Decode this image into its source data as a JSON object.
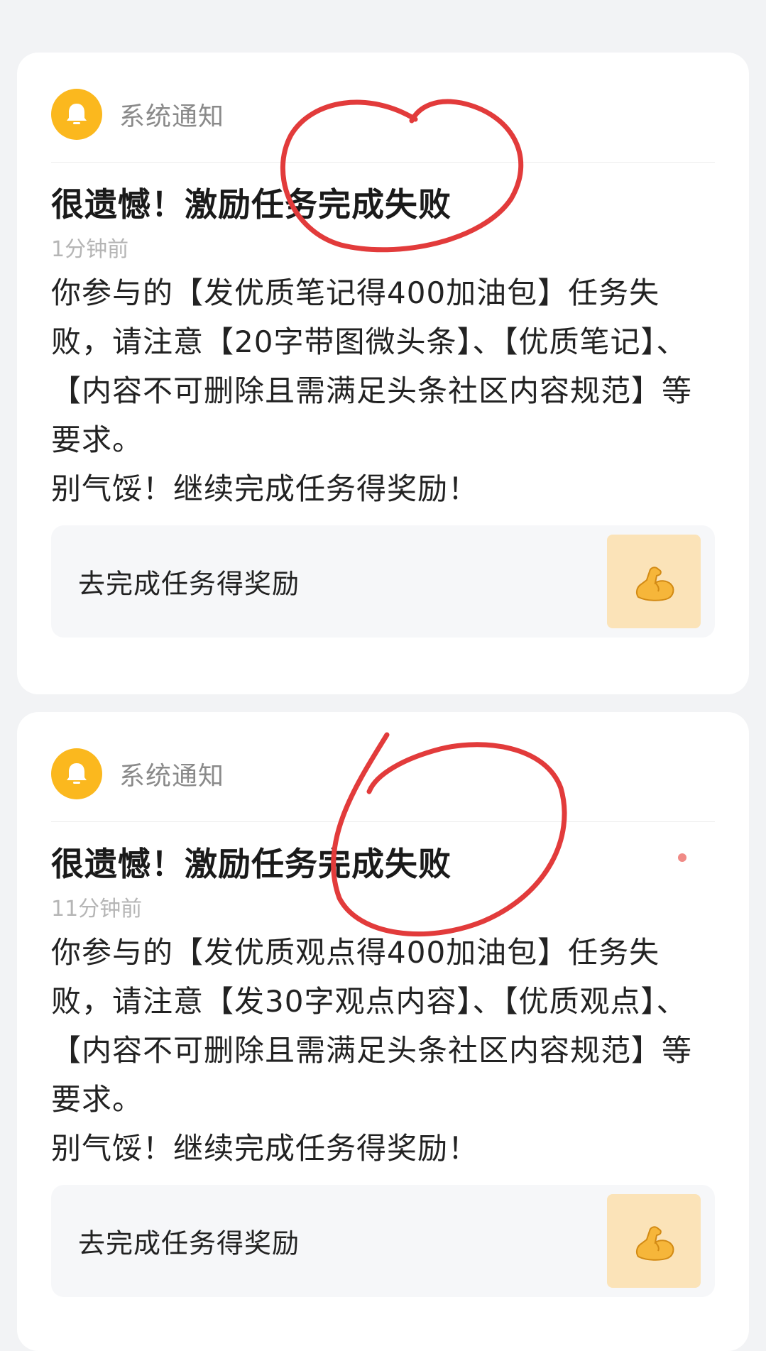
{
  "notifications": [
    {
      "sender": "系统通知",
      "title": "很遗憾！激励任务完成失败",
      "time": "1分钟前",
      "body_lines": [
        "你参与的【发优质笔记得400加油包】任务失败，请注意【20字带图微头条】、【优质笔记】、【内容不可删除且需满足头条社区内容规范】等要求。",
        "别气馁！继续完成任务得奖励！"
      ],
      "action_label": "去完成任务得奖励",
      "action_icon": "flexed-biceps-icon",
      "unread": false
    },
    {
      "sender": "系统通知",
      "title": "很遗憾！激励任务完成失败",
      "time": "11分钟前",
      "body_lines": [
        "你参与的【发优质观点得400加油包】任务失败，请注意【发30字观点内容】、【优质观点】、【内容不可删除且需满足头条社区内容规范】等要求。",
        "别气馁！继续完成任务得奖励！"
      ],
      "action_label": "去完成任务得奖励",
      "action_icon": "flexed-biceps-icon",
      "unread": true
    }
  ],
  "colors": {
    "background": "#f2f3f5",
    "card": "#ffffff",
    "bell_avatar": "#fbb81e",
    "annotation_circle": "#e23b3b",
    "unread_dot": "#f08a86",
    "action_thumb": "#fbe3b8"
  }
}
